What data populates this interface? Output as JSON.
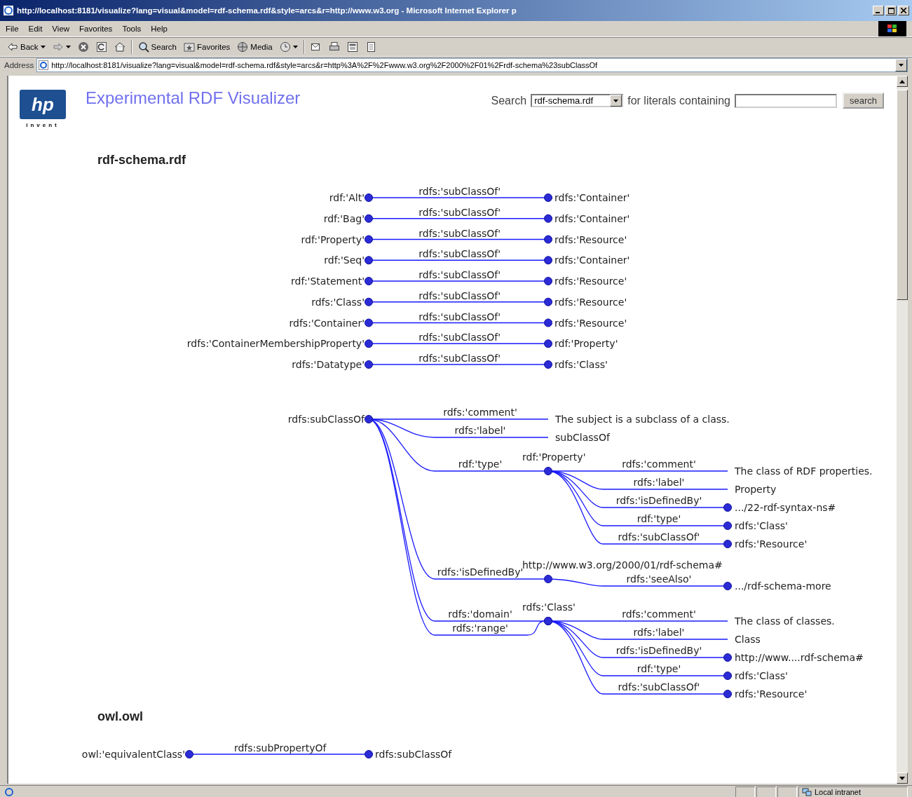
{
  "window": {
    "title": "http://localhost:8181/visualize?lang=visual&model=rdf-schema.rdf&style=arcs&r=http://www.w3.org - Microsoft Internet Explorer p"
  },
  "menu": [
    "File",
    "Edit",
    "View",
    "Favorites",
    "Tools",
    "Help"
  ],
  "toolbar": [
    {
      "kind": "back",
      "label": "Back"
    },
    {
      "kind": "forward"
    },
    {
      "kind": "stop"
    },
    {
      "kind": "refresh"
    },
    {
      "kind": "home"
    },
    {
      "kind": "search",
      "label": "Search"
    },
    {
      "kind": "favorites",
      "label": "Favorites"
    },
    {
      "kind": "media",
      "label": "Media"
    },
    {
      "kind": "history"
    },
    {
      "kind": "mail"
    },
    {
      "kind": "print"
    },
    {
      "kind": "edit"
    },
    {
      "kind": "discuss"
    }
  ],
  "address": {
    "label": "Address",
    "value": "http://localhost:8181/visualize?lang=visual&model=rdf-schema.rdf&style=arcs&r=http%3A%2F%2Fwww.w3.org%2F2000%2F01%2Frdf-schema%23subClassOf"
  },
  "header": {
    "logo_mark": "hp",
    "logo_tagline": "invent",
    "title": "Experimental RDF Visualizer"
  },
  "search": {
    "label": "Search",
    "model": "rdf-schema.rdf",
    "between": "for literals containing",
    "button": "search"
  },
  "sections": [
    {
      "title": "rdf-schema.rdf",
      "graphs": [
        {
          "kind": "triples",
          "rows": [
            {
              "subject": "rdf:'Alt'",
              "predicate": "rdfs:'subClassOf'",
              "object": "rdfs:'Container'"
            },
            {
              "subject": "rdf:'Bag'",
              "predicate": "rdfs:'subClassOf'",
              "object": "rdfs:'Container'"
            },
            {
              "subject": "rdf:'Property'",
              "predicate": "rdfs:'subClassOf'",
              "object": "rdfs:'Resource'"
            },
            {
              "subject": "rdf:'Seq'",
              "predicate": "rdfs:'subClassOf'",
              "object": "rdfs:'Container'"
            },
            {
              "subject": "rdf:'Statement'",
              "predicate": "rdfs:'subClassOf'",
              "object": "rdfs:'Resource'"
            },
            {
              "subject": "rdfs:'Class'",
              "predicate": "rdfs:'subClassOf'",
              "object": "rdfs:'Resource'"
            },
            {
              "subject": "rdfs:'Container'",
              "predicate": "rdfs:'subClassOf'",
              "object": "rdfs:'Resource'"
            },
            {
              "subject": "rdfs:'ContainerMembershipProperty'",
              "predicate": "rdfs:'subClassOf'",
              "object": "rdf:'Property'"
            },
            {
              "subject": "rdfs:'Datatype'",
              "predicate": "rdfs:'subClassOf'",
              "object": "rdfs:'Class'"
            }
          ]
        },
        {
          "kind": "tree",
          "root": "rdfs:subClassOf",
          "arcs": [
            {
              "kind": "literal",
              "predicate": "rdfs:'comment'",
              "object": "The subject is a subclass of a class."
            },
            {
              "kind": "literal",
              "predicate": "rdfs:'label'",
              "object": "subClassOf"
            },
            {
              "kind": "node",
              "predicate": "rdf:'type'",
              "object": "rdf:'Property'",
              "children": [
                {
                  "kind": "literal",
                  "predicate": "rdfs:'comment'",
                  "object": "The class of RDF properties."
                },
                {
                  "kind": "literal",
                  "predicate": "rdfs:'label'",
                  "object": "Property"
                },
                {
                  "kind": "resource",
                  "predicate": "rdfs:'isDefinedBy'",
                  "object": ".../22-rdf-syntax-ns#"
                },
                {
                  "kind": "resource",
                  "predicate": "rdf:'type'",
                  "object": "rdfs:'Class'"
                },
                {
                  "kind": "resource",
                  "predicate": "rdfs:'subClassOf'",
                  "object": "rdfs:'Resource'"
                }
              ]
            },
            {
              "kind": "node",
              "predicate": "rdfs:'isDefinedBy'",
              "object": "http://www.w3.org/2000/01/rdf-schema#",
              "children": [
                {
                  "kind": "resource",
                  "predicate": "rdfs:'seeAlso'",
                  "object": ".../rdf-schema-more"
                }
              ]
            },
            {
              "kind": "node",
              "predicate": "rdfs:'domain'",
              "object": "rdfs:'Class'",
              "children": [
                {
                  "kind": "literal",
                  "predicate": "rdfs:'comment'",
                  "object": "The class of classes."
                },
                {
                  "kind": "literal",
                  "predicate": "rdfs:'label'",
                  "object": "Class"
                },
                {
                  "kind": "resource",
                  "predicate": "rdfs:'isDefinedBy'",
                  "object": "http://www....rdf-schema#"
                },
                {
                  "kind": "resource",
                  "predicate": "rdf:'type'",
                  "object": "rdfs:'Class'"
                },
                {
                  "kind": "resource",
                  "predicate": "rdfs:'subClassOf'",
                  "object": "rdfs:'Resource'"
                }
              ]
            },
            {
              "kind": "shared",
              "predicate": "rdfs:'range'"
            }
          ]
        }
      ]
    },
    {
      "title": "owl.owl",
      "graphs": [
        {
          "kind": "chain",
          "rows": [
            {
              "subject": "owl:'equivalentClass'",
              "predicate": "rdfs:subPropertyOf",
              "object": "rdfs:subClassOf"
            }
          ]
        }
      ]
    }
  ],
  "status": {
    "zone": "Local intranet"
  }
}
